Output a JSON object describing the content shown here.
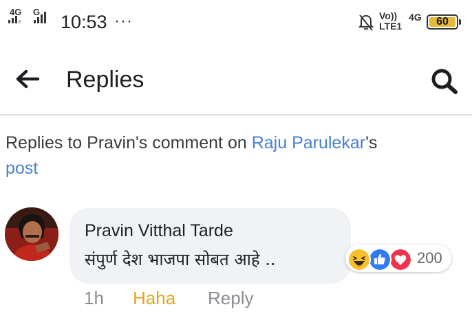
{
  "status_bar": {
    "sim1_label": "4G",
    "sim2_label": "G",
    "time": "10:53",
    "overflow": "···",
    "volte_top": "Vo))",
    "volte_bottom": "LTE1",
    "network": "4G",
    "battery": "60",
    "battery_color": "#e6b83a"
  },
  "header": {
    "title": "Replies",
    "back_icon": "arrow-left-icon",
    "search_icon": "search-icon"
  },
  "context": {
    "prefix": "Replies to Pravin's comment on ",
    "page_name": "Raju Parulekar",
    "suffix_1": "'s",
    "suffix_2": "post"
  },
  "comment": {
    "author": "Pravin Vitthal Tarde",
    "text": "संपुर्ण देश भाजपा सोबत आहे ..",
    "reactions": {
      "icons": [
        "haha-icon",
        "like-icon",
        "love-icon"
      ],
      "count": "200"
    },
    "time": "1h",
    "reaction_action": "Haha",
    "reply_action": "Reply"
  },
  "colors": {
    "link": "#4a80d0",
    "haha_action": "#e4a51f",
    "bubble": "#f0f2f5"
  }
}
